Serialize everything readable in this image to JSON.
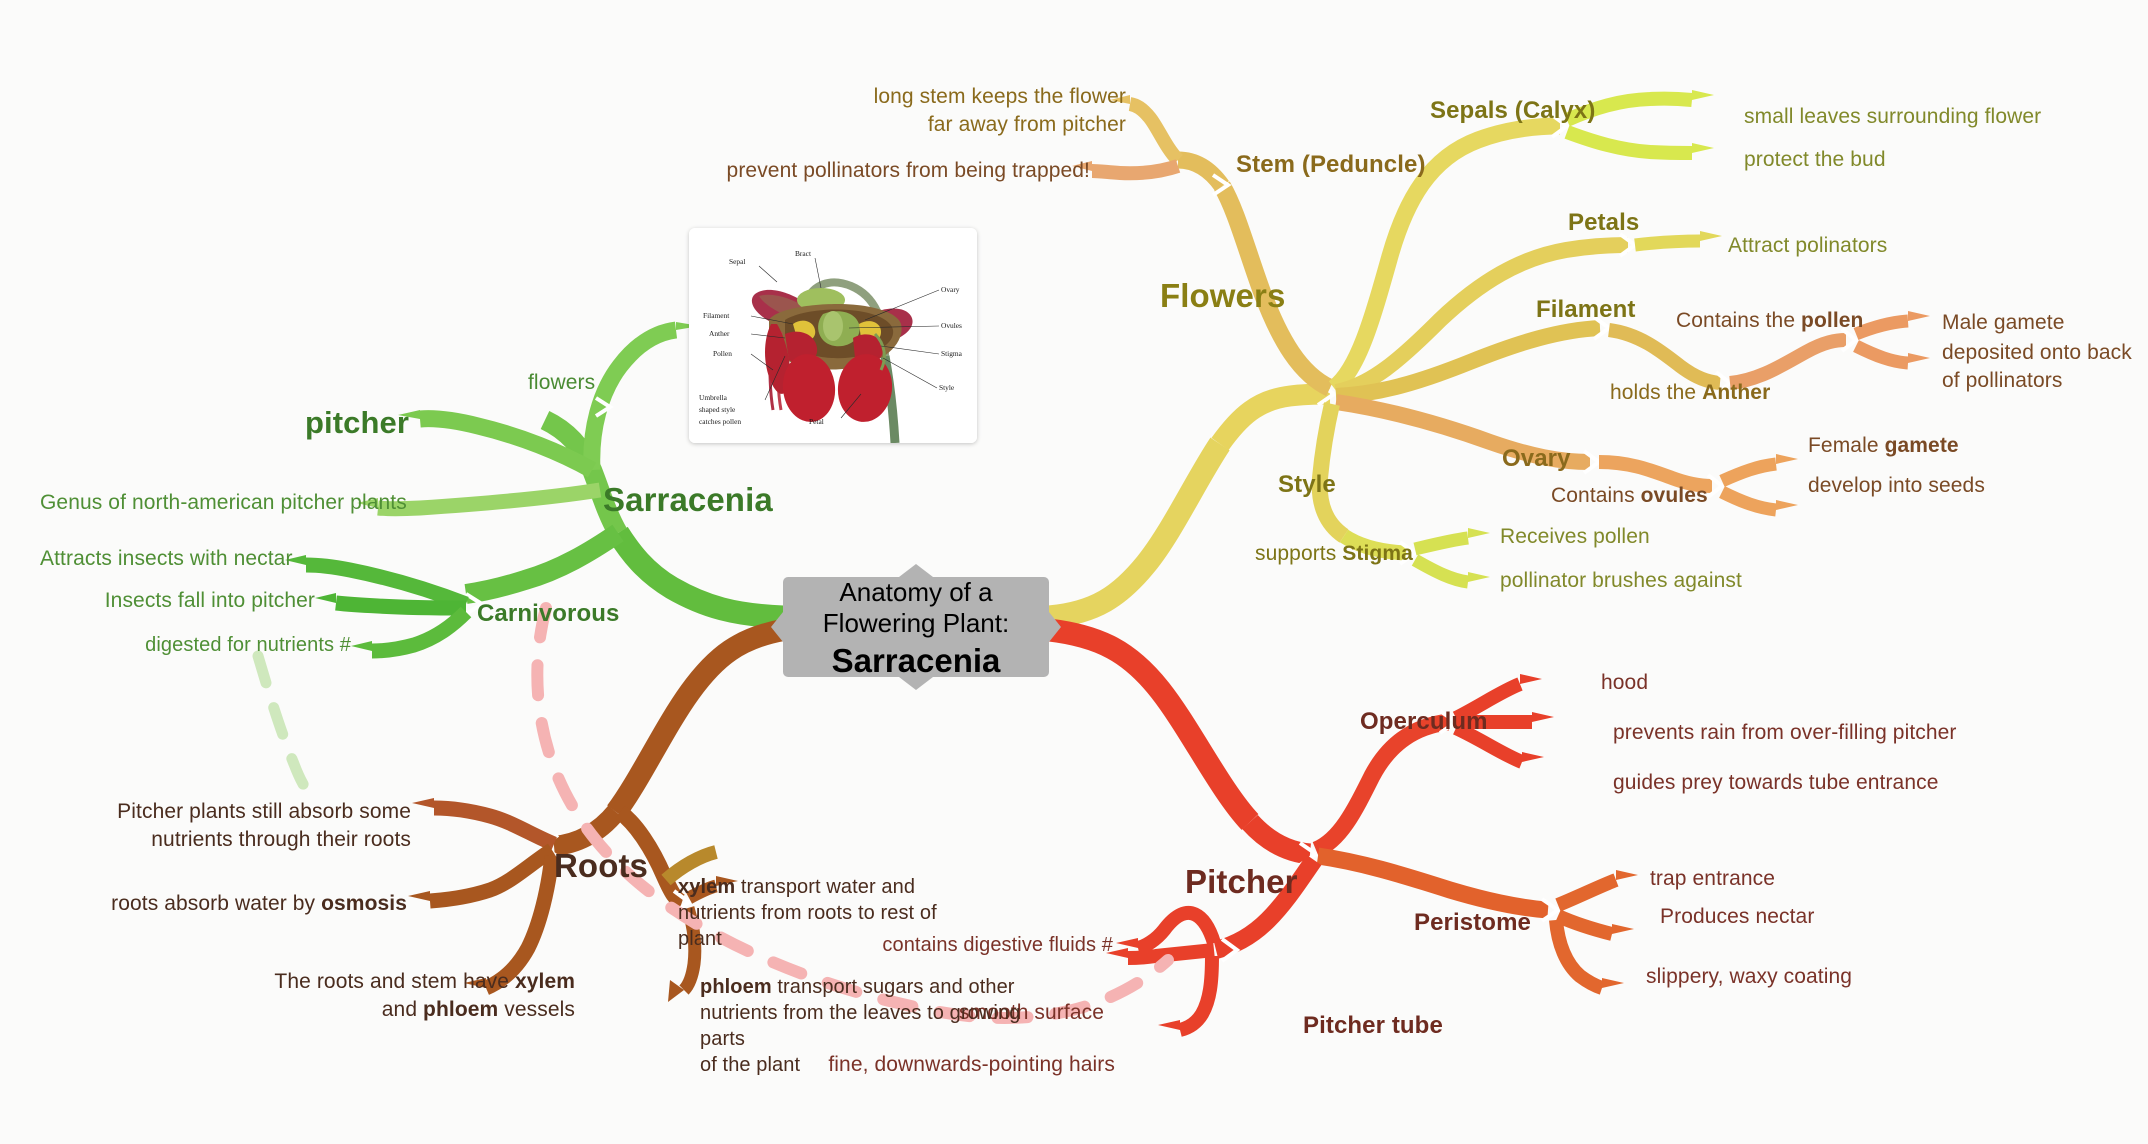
{
  "central": {
    "line1": "Anatomy of a",
    "line2": "Flowering Plant:",
    "line3": "Sarracenia"
  },
  "illustration": {
    "caption_labels": [
      "Sepal",
      "Bract",
      "Ovary",
      "Filament",
      "Ovules",
      "Anther",
      "Stigma",
      "Pollen",
      "Style",
      "Petal"
    ],
    "multiline_label": [
      "Umbrella",
      "shaped style",
      "catches pollen"
    ]
  },
  "branches": {
    "sarracenia": {
      "label": "Sarracenia",
      "color": "#3b7a28",
      "children": [
        {
          "label": "flowers"
        },
        {
          "label": "pitcher"
        },
        {
          "label": "Genus of north-american pitcher plants"
        },
        {
          "label": "Carnivorous",
          "children": [
            {
              "label": "Attracts insects with nectar"
            },
            {
              "label": "Insects fall into pitcher"
            },
            {
              "label": "digested for nutrients #"
            }
          ]
        }
      ]
    },
    "flowers": {
      "label": "Flowers",
      "color": "#8a7f14",
      "children": [
        {
          "label": "Stem (Peduncle)",
          "children": [
            {
              "line1": "long stem keeps the flower",
              "line2": "far away from pitcher"
            },
            {
              "label": "prevent pollinators from being trapped!"
            }
          ]
        },
        {
          "label": "Sepals (Calyx)",
          "children": [
            {
              "label": "small leaves surrounding flower"
            },
            {
              "label": "protect the bud"
            }
          ]
        },
        {
          "label": "Petals",
          "children": [
            {
              "label": "Attract polinators"
            }
          ]
        },
        {
          "label": "Filament",
          "children": [
            {
              "label": "Contains the ",
              "bold": "pollen"
            },
            {
              "label": "holds the ",
              "bold": "Anther"
            }
          ],
          "grandchildren": [
            {
              "label": "Male gamete"
            },
            {
              "line1": "deposited onto back",
              "line2": "of pollinators"
            }
          ]
        },
        {
          "label": "Ovary",
          "children": [
            {
              "label": "Contains ",
              "bold": "ovules"
            }
          ],
          "grandchildren": [
            {
              "pre": "Female ",
              "bold": "gamete"
            },
            {
              "label": "develop into seeds"
            }
          ]
        },
        {
          "label": "Style",
          "children": [
            {
              "pre": "supports ",
              "bold": "Stigma"
            }
          ],
          "grandchildren": [
            {
              "label": "Receives pollen"
            },
            {
              "label": "pollinator brushes against"
            }
          ]
        }
      ]
    },
    "pitcher": {
      "label": "Pitcher",
      "color": "#8a2f22",
      "children": [
        {
          "label": "Operculum",
          "children": [
            {
              "label": "hood"
            },
            {
              "label": "prevents rain from over-filling pitcher"
            },
            {
              "label": "guides prey towards tube entrance"
            }
          ]
        },
        {
          "label": "Peristome",
          "children": [
            {
              "label": "trap entrance"
            },
            {
              "label": "Produces nectar"
            },
            {
              "label": "slippery, waxy coating"
            }
          ]
        },
        {
          "label": "Pitcher tube",
          "children": [
            {
              "label": "contains digestive fluids #"
            },
            {
              "label": "smooth surface"
            },
            {
              "label": "fine, downwards-pointing hairs"
            }
          ]
        }
      ]
    },
    "roots": {
      "label": "Roots",
      "color": "#4a2c1e",
      "children": [
        {
          "line1": "Pitcher plants still absorb some",
          "line2": "nutrients through their roots"
        },
        {
          "pre": "roots absorb water by ",
          "bold": "osmosis"
        },
        {
          "pre1": "The roots and stem have ",
          "bold1": "xylem",
          "pre2": "and ",
          "bold2": "phloem",
          "post2": " vessels"
        },
        {
          "bold": "xylem",
          "line1": " transport water and",
          "line2": "nutrients from roots to rest of",
          "line3": "plant"
        },
        {
          "bold": "phloem",
          "line1": " transport sugars and other",
          "line2": "nutrients from the leaves to growing",
          "line3": "parts",
          "line4": "of the plant"
        }
      ]
    }
  },
  "relationships": [
    {
      "from": "digested for nutrients #",
      "to": "contains digestive fluids #",
      "style": "dashed",
      "color": "#f5b3b3"
    }
  ],
  "colors": {
    "background": "#fbfbfa",
    "central_node": "#b3b3b3",
    "green_branch": "#7ac943",
    "green_dark": "#4caf3f",
    "yellow_branch": "#e8dd62",
    "amber_branch": "#e2b95a",
    "orange_branch": "#e89a5f",
    "red_branch": "#e8402a",
    "red_orange": "#e2622c",
    "brown_branch": "#a8571f",
    "relationship_pink": "#f5b3b3",
    "relationship_green": "#cfe8bd"
  }
}
